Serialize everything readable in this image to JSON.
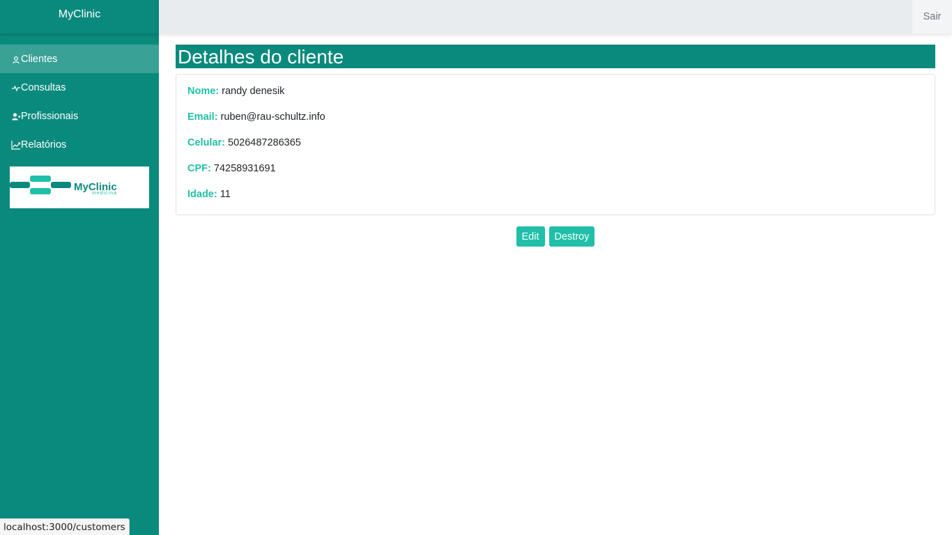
{
  "app": {
    "brand": "MyClinic"
  },
  "sidebar": {
    "items": [
      {
        "label": "Clientes",
        "icon": "user-icon",
        "active": true
      },
      {
        "label": "Consultas",
        "icon": "activity-icon",
        "active": false
      },
      {
        "label": "Profissionais",
        "icon": "users-icon",
        "active": false
      },
      {
        "label": "Relatórios",
        "icon": "chart-icon",
        "active": false
      }
    ],
    "logo": {
      "name": "MyClinic",
      "tagline": "medicina"
    }
  },
  "topbar": {
    "logout_label": "Sair"
  },
  "page": {
    "title": "Detalhes do cliente",
    "fields": [
      {
        "label": "Nome:",
        "value": "randy denesik"
      },
      {
        "label": "Email:",
        "value": "ruben@rau-schultz.info"
      },
      {
        "label": "Celular:",
        "value": "5026487286365"
      },
      {
        "label": "CPF:",
        "value": "74258931691"
      },
      {
        "label": "Idade:",
        "value": "11"
      }
    ],
    "actions": {
      "edit_label": "Edit",
      "destroy_label": "Destroy"
    }
  },
  "statusbar": {
    "url": "localhost:3000/customers"
  },
  "colors": {
    "sidebar": "#0a8a7d",
    "accent": "#20bfa9",
    "active_item": "#3aa196",
    "topbar": "#e9ecef"
  }
}
